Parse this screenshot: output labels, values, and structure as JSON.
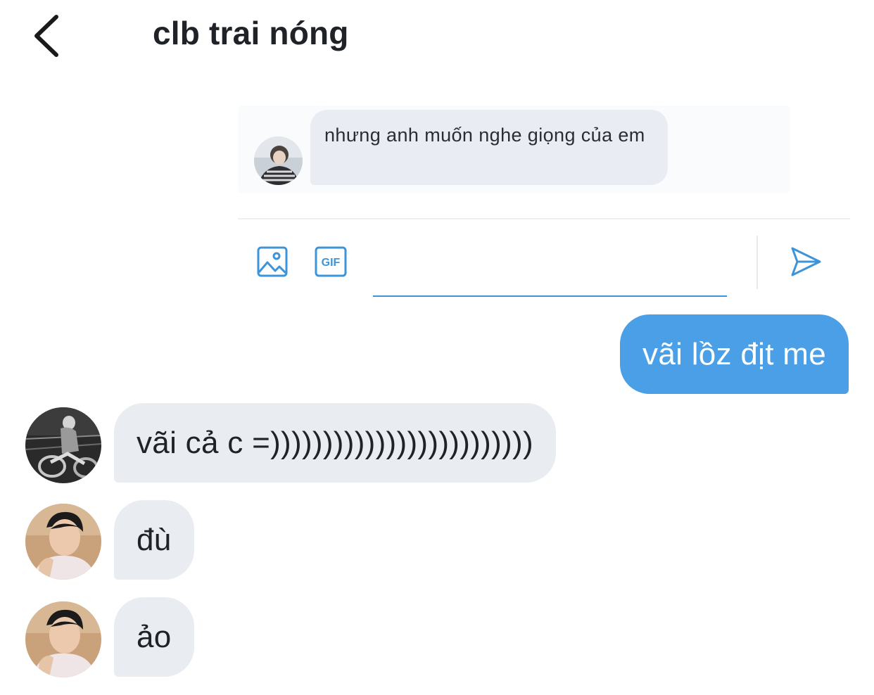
{
  "header": {
    "title": "clb trai nóng",
    "back_icon": "chevron-left-icon"
  },
  "embedded_screenshot": {
    "message_text": "nhưng anh muốn nghe giọng của em",
    "composer": {
      "image_icon": "image-icon",
      "gif_label": "GIF",
      "input_value": "",
      "send_icon": "send-icon"
    },
    "accent_color": "#3d94d9"
  },
  "messages": [
    {
      "direction": "outgoing",
      "text": "vãi lồz địt me"
    },
    {
      "direction": "incoming",
      "avatar": "avatar-1",
      "text": "vãi cả c =)))))))))))))))))))))))))"
    },
    {
      "direction": "incoming",
      "avatar": "avatar-2",
      "text": "đù"
    },
    {
      "direction": "incoming",
      "avatar": "avatar-2",
      "text": "ảo"
    }
  ],
  "colors": {
    "outgoing_bubble": "#4a9fe6",
    "incoming_bubble": "#e9ecf1",
    "title_text": "#1f2328"
  }
}
